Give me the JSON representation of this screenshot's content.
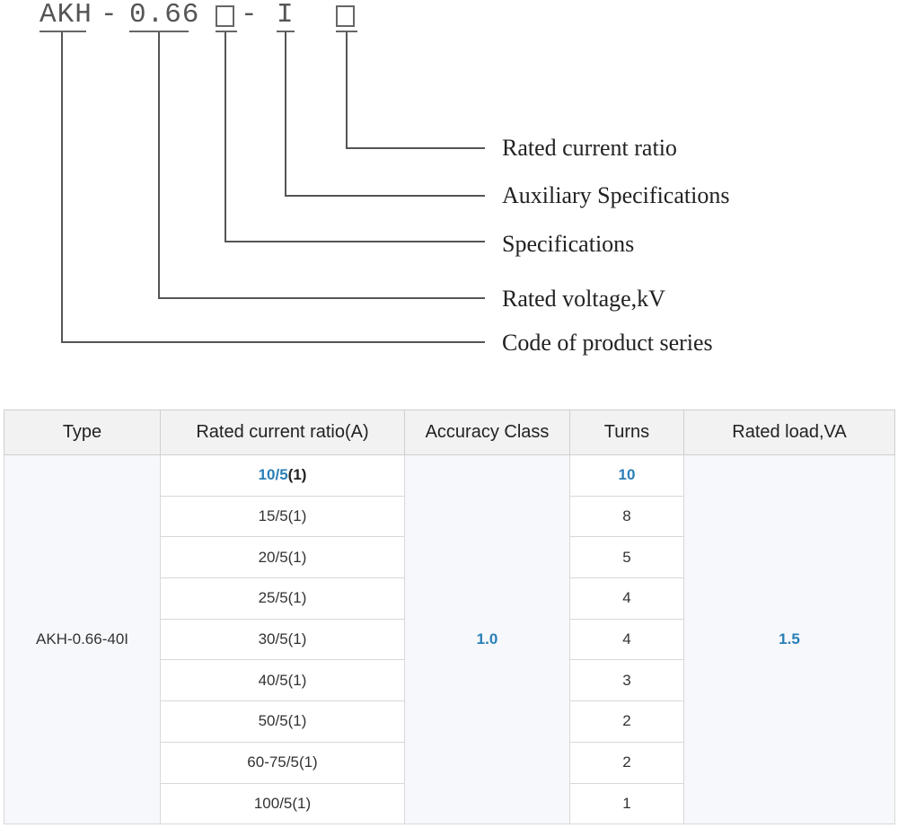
{
  "model_code": {
    "prefix": "AKH",
    "dash1": "-",
    "voltage": "0.66",
    "dash2": "-",
    "aux": "I"
  },
  "legend": [
    "Rated current ratio",
    "Auxiliary Specifications",
    "Specifications",
    "Rated voltage,kV",
    "Code of product series"
  ],
  "table": {
    "headers": [
      "Type",
      "Rated current ratio(A)",
      "Accuracy Class",
      "Turns",
      "Rated load,VA"
    ],
    "type": "AKH-0.66-40I",
    "accuracy_class": "1.0",
    "rated_load": "1.5",
    "first_ratio": {
      "primary": "10/5",
      "secondary": "(1)"
    },
    "rows": [
      {
        "ratio": "15/5(1)",
        "turns": "8"
      },
      {
        "ratio": "20/5(1)",
        "turns": "5"
      },
      {
        "ratio": "25/5(1)",
        "turns": "4"
      },
      {
        "ratio": "30/5(1)",
        "turns": "4"
      },
      {
        "ratio": "40/5(1)",
        "turns": "3"
      },
      {
        "ratio": "50/5(1)",
        "turns": "2"
      },
      {
        "ratio": "60-75/5(1)",
        "turns": "2"
      },
      {
        "ratio": "100/5(1)",
        "turns": "1"
      }
    ],
    "first_turns": "10"
  }
}
